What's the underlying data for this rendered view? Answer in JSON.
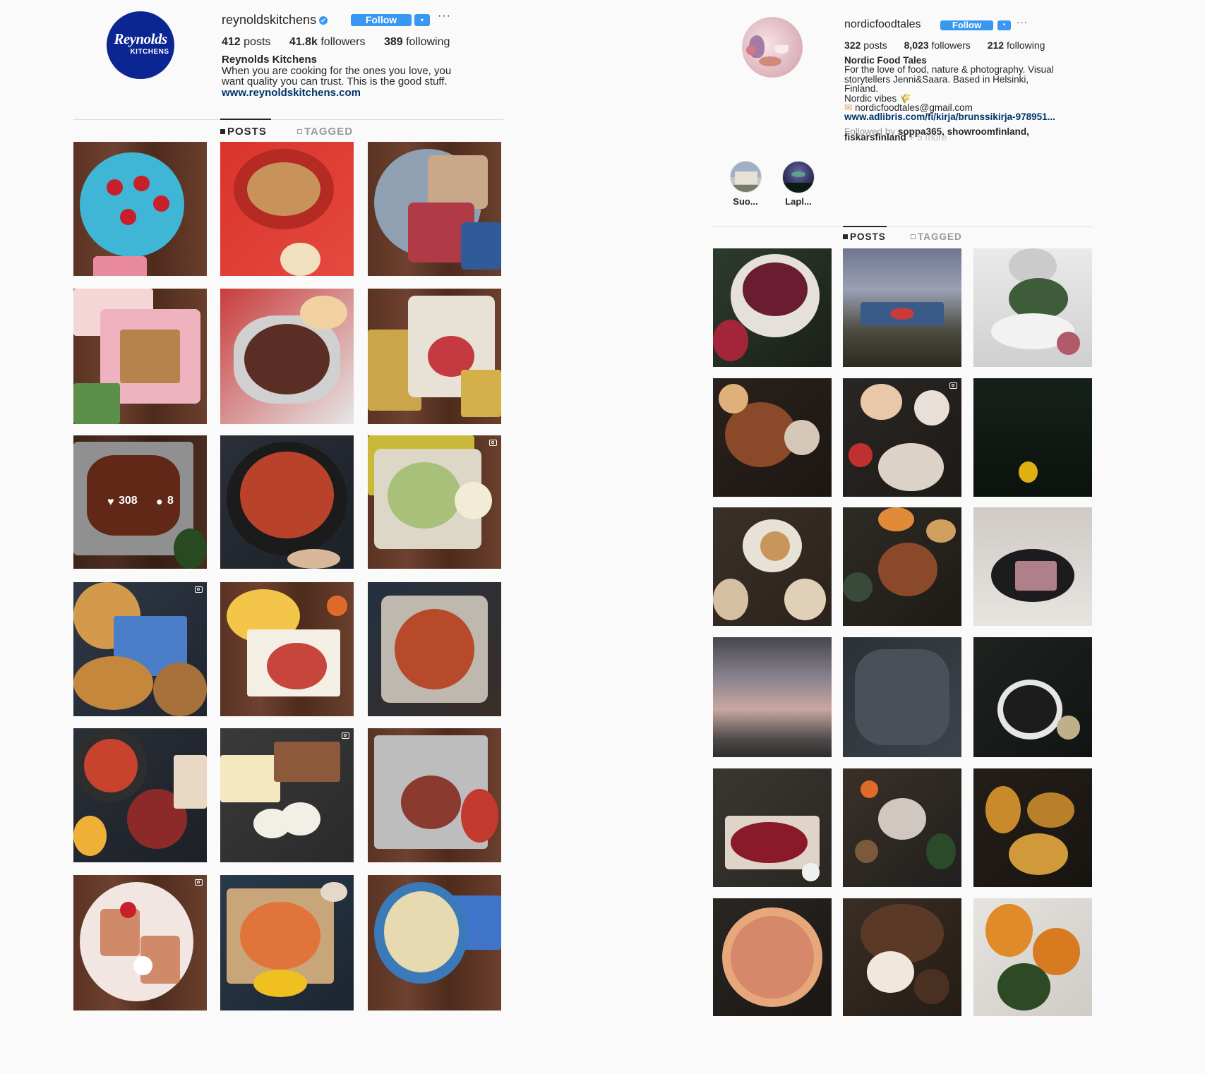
{
  "left_profile": {
    "avatar_text_line1": "Reynolds",
    "avatar_text_line2": "KITCHENS",
    "username": "reynoldskitchens",
    "verified_glyph": "✔",
    "follow_label": "Follow",
    "dropdown_glyph": "▾",
    "more_glyph": "···",
    "stats": {
      "posts_num": "412",
      "posts_label": "posts",
      "followers_num": "41.8k",
      "followers_label": "followers",
      "following_num": "389",
      "following_label": "following"
    },
    "full_name": "Reynolds Kitchens",
    "bio_line1": "When you are cooking for the ones you love, you",
    "bio_line2": "want quality you can trust. This is the good stuff.",
    "website": "www.reynoldskitchens.com",
    "tabs": {
      "posts": "POSTS",
      "tagged": "TAGGED"
    },
    "hover_likes": "308",
    "hover_comments": "8",
    "heart_glyph": "♥",
    "bubble_glyph": "●"
  },
  "right_profile": {
    "username": "nordicfoodtales",
    "follow_label": "Follow",
    "dropdown_glyph": "▾",
    "more_glyph": "···",
    "stats": {
      "posts_num": "322",
      "posts_label": "posts",
      "followers_num": "8,023",
      "followers_label": "followers",
      "following_num": "212",
      "following_label": "following"
    },
    "full_name": "Nordic Food Tales",
    "bio_line1": "For the love of food, nature & photography. Visual",
    "bio_line2": "storytellers Jenni&Saara. Based in Helsinki,",
    "bio_line3": "Finland.",
    "bio_line4": "Nordic vibes 🌾",
    "email_emoji": "✉",
    "email": "nordicfoodtales@gmail.com",
    "website": "www.adlibris.com/fi/kirja/brunssikirja-978951...",
    "followed_by_prefix": "Followed by",
    "followed_by_names": "soppa365, showroomfinland,",
    "followed_by_line2": "fiskarsfinland",
    "followed_by_more": "+ 5 more",
    "highlights": [
      {
        "label": "Suo..."
      },
      {
        "label": "Lapl..."
      }
    ],
    "tabs": {
      "posts": "POSTS",
      "tagged": "TAGGED"
    }
  },
  "colors": {
    "follow_blue": "#3897f0",
    "brand_navy": "#0b2592",
    "link": "#003569",
    "divider": "#dbdbdb",
    "background": "#fafafa"
  },
  "icons": [
    "verified-icon",
    "dropdown-icon",
    "more-icon",
    "grid-icon",
    "tag-icon",
    "video-icon",
    "heart-icon",
    "comment-icon",
    "email-icon"
  ]
}
